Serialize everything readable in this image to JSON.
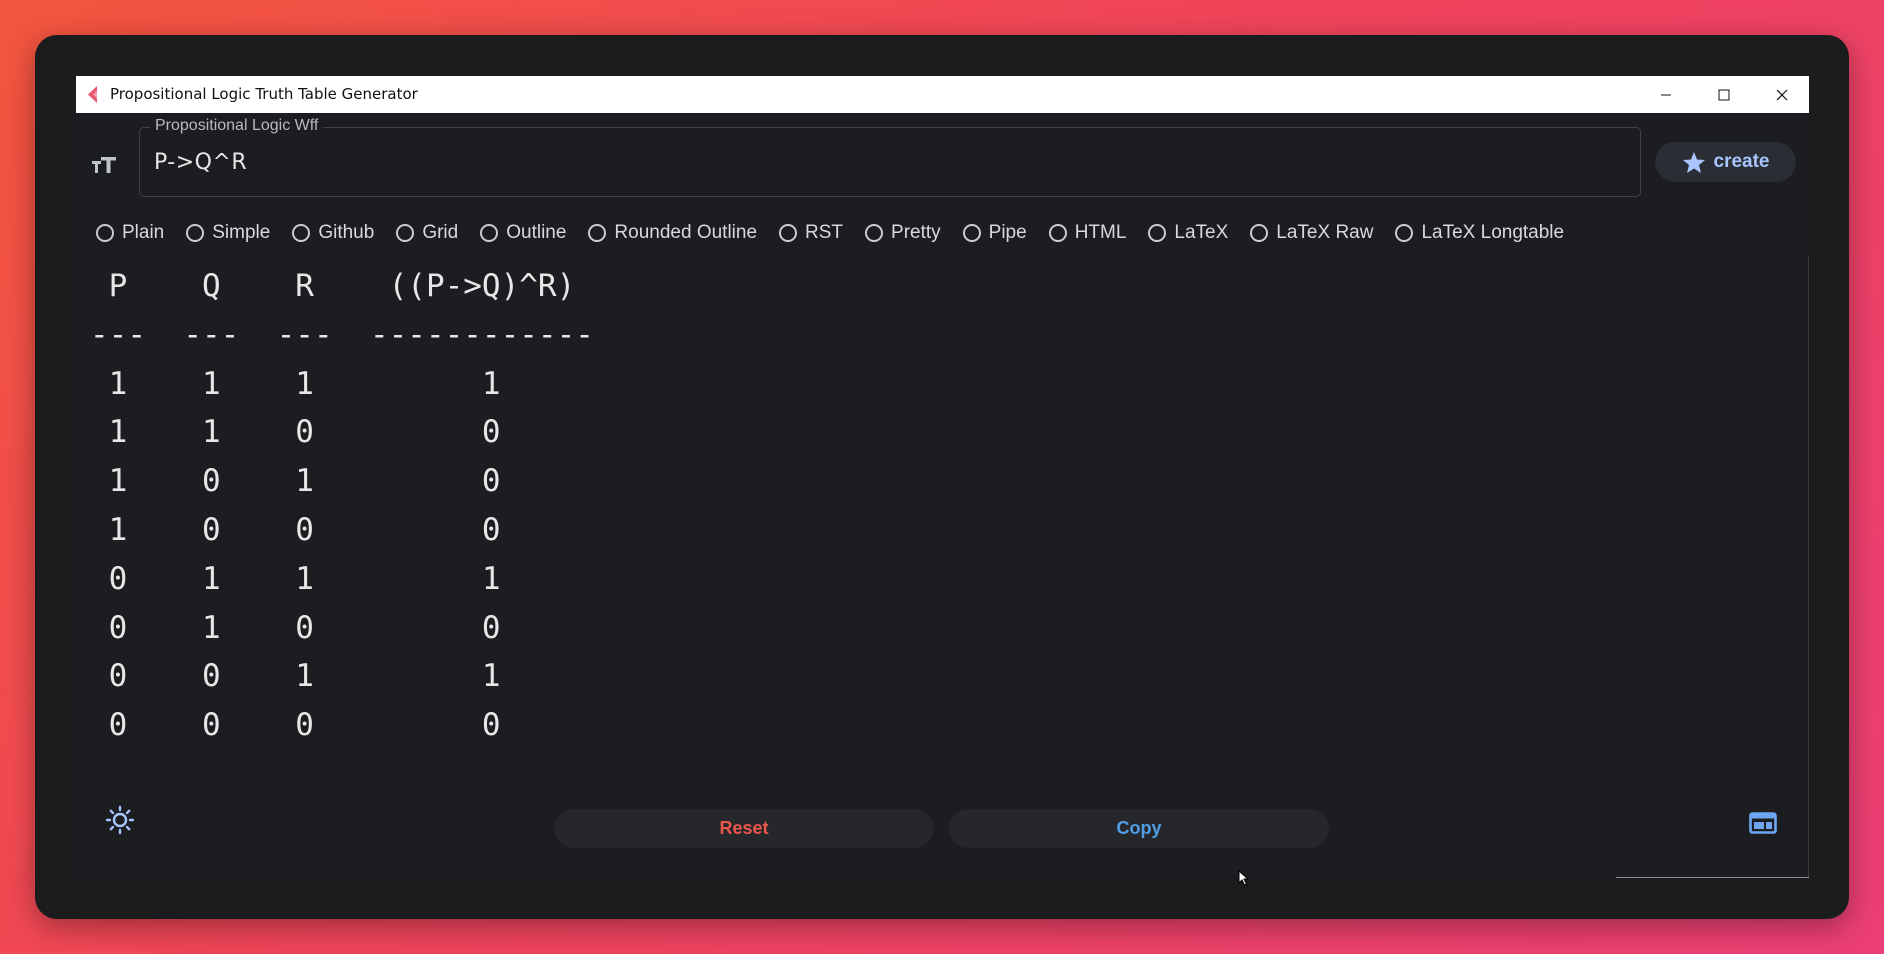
{
  "window": {
    "title": "Propositional Logic Truth Table Generator"
  },
  "input": {
    "label": "Propositional Logic Wff",
    "value": "P->Q^R"
  },
  "create_button": {
    "label": "create"
  },
  "formats": [
    "Plain",
    "Simple",
    "Github",
    "Grid",
    "Outline",
    "Rounded Outline",
    "RST",
    "Pretty",
    "Pipe",
    "HTML",
    "LaTeX",
    "LaTeX Raw",
    "LaTeX Longtable"
  ],
  "truth_table": {
    "headers": [
      "P",
      "Q",
      "R",
      "((P->Q)^R)"
    ],
    "rows": [
      [
        1,
        1,
        1,
        1
      ],
      [
        1,
        1,
        0,
        0
      ],
      [
        1,
        0,
        1,
        0
      ],
      [
        1,
        0,
        0,
        0
      ],
      [
        0,
        1,
        1,
        1
      ],
      [
        0,
        1,
        0,
        0
      ],
      [
        0,
        0,
        1,
        1
      ],
      [
        0,
        0,
        0,
        0
      ]
    ],
    "text": " P    Q    R    ((P->Q)^R)\n---  ---  ---  ------------\n 1    1    1         1\n 1    1    0         0\n 1    0    1         0\n 1    0    0         0\n 0    1    1         1\n 0    1    0         0\n 0    0    1         1\n 0    0    0         0"
  },
  "actions": {
    "reset_label": "Reset",
    "copy_label": "Copy"
  },
  "colors": {
    "accent": "#a8c5ff",
    "reset": "#e8564c",
    "copy": "#4f9fe6",
    "background": "#1c1d20"
  }
}
